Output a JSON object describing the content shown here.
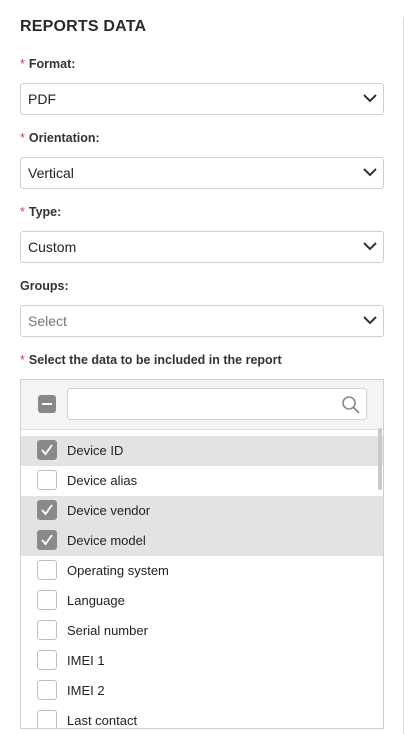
{
  "section_title": "REPORTS DATA",
  "required_mark": "*",
  "format": {
    "label": "Format:",
    "value": "PDF"
  },
  "orientation": {
    "label": "Orientation:",
    "value": "Vertical"
  },
  "type": {
    "label": "Type:",
    "value": "Custom"
  },
  "groups": {
    "label": "Groups:",
    "placeholder": "Select"
  },
  "data_selection": {
    "label": "Select the data to be included in the report",
    "search_value": "",
    "items": [
      {
        "label": "Device ID",
        "checked": true
      },
      {
        "label": "Device alias",
        "checked": false
      },
      {
        "label": "Device vendor",
        "checked": true
      },
      {
        "label": "Device model",
        "checked": true
      },
      {
        "label": "Operating system",
        "checked": false
      },
      {
        "label": "Language",
        "checked": false
      },
      {
        "label": "Serial number",
        "checked": false
      },
      {
        "label": "IMEI 1",
        "checked": false
      },
      {
        "label": "IMEI 2",
        "checked": false
      },
      {
        "label": "Last contact",
        "checked": false
      }
    ]
  },
  "icons": {
    "dropdown": "chevron-down-icon",
    "search": "search-icon",
    "check": "checkmark-icon",
    "deselect": "minus-icon"
  },
  "colors": {
    "required": "#e53935",
    "selected_row": "#e3e3e3",
    "checkbox_checked": "#8a8a8a"
  }
}
